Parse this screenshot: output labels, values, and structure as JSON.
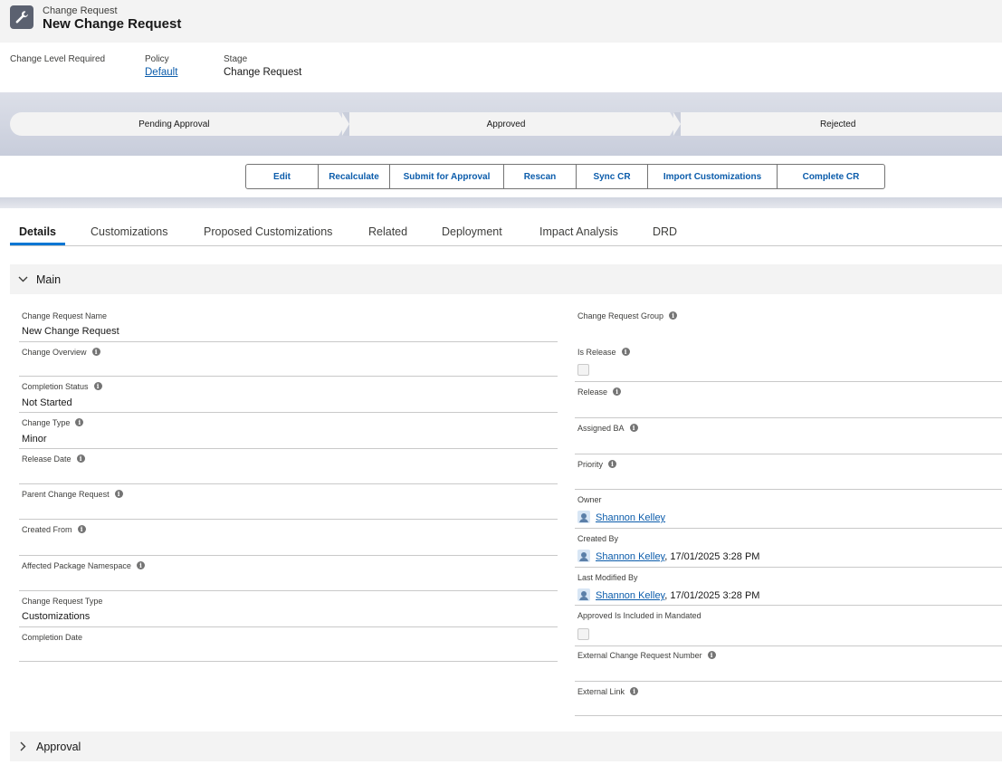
{
  "header": {
    "object_type": "Change Request",
    "record_title": "New Change Request",
    "icon": "wrench-icon"
  },
  "highlights": {
    "change_level": {
      "label": "Change Level Required"
    },
    "policy": {
      "label": "Policy",
      "value": "Default"
    },
    "stage": {
      "label": "Stage",
      "value": "Change Request"
    }
  },
  "path": {
    "stages": [
      "Pending Approval",
      "Approved",
      "Rejected"
    ]
  },
  "actions": [
    "Edit",
    "Recalculate",
    "Submit for Approval",
    "Rescan",
    "Sync CR",
    "Import Customizations",
    "Complete CR"
  ],
  "tabs": [
    "Details",
    "Customizations",
    "Proposed Customizations",
    "Related",
    "Deployment",
    "Impact Analysis",
    "DRD"
  ],
  "sections": {
    "main": "Main",
    "approval": "Approval"
  },
  "fields_left": {
    "name": {
      "label": "Change Request Name",
      "value": "New Change Request"
    },
    "overview": {
      "label": "Change Overview"
    },
    "completion_status": {
      "label": "Completion Status",
      "value": "Not Started"
    },
    "change_type": {
      "label": "Change Type",
      "value": "Minor"
    },
    "release_date": {
      "label": "Release Date"
    },
    "parent": {
      "label": "Parent Change Request"
    },
    "created_from": {
      "label": "Created From"
    },
    "namespace": {
      "label": "Affected Package Namespace"
    },
    "cr_type": {
      "label": "Change Request Type",
      "value": "Customizations"
    },
    "completion_date": {
      "label": "Completion Date"
    }
  },
  "fields_right": {
    "group": {
      "label": "Change Request Group"
    },
    "is_release": {
      "label": "Is Release"
    },
    "release": {
      "label": "Release"
    },
    "assigned_ba": {
      "label": "Assigned BA"
    },
    "priority": {
      "label": "Priority"
    },
    "owner": {
      "label": "Owner",
      "user": "Shannon Kelley"
    },
    "created_by": {
      "label": "Created By",
      "user": "Shannon Kelley",
      "date": ", 17/01/2025 3:28 PM"
    },
    "modified_by": {
      "label": "Last Modified By",
      "user": "Shannon Kelley",
      "date": ", 17/01/2025 3:28 PM"
    },
    "mandated": {
      "label": "Approved Is Included in Mandated"
    },
    "ext_number": {
      "label": "External Change Request Number"
    },
    "ext_link": {
      "label": "External Link"
    }
  },
  "info_glyph": "i",
  "colors": {
    "link": "#0b5cab",
    "tab_active": "#0176d3",
    "icon_bg": "#5b6170"
  }
}
